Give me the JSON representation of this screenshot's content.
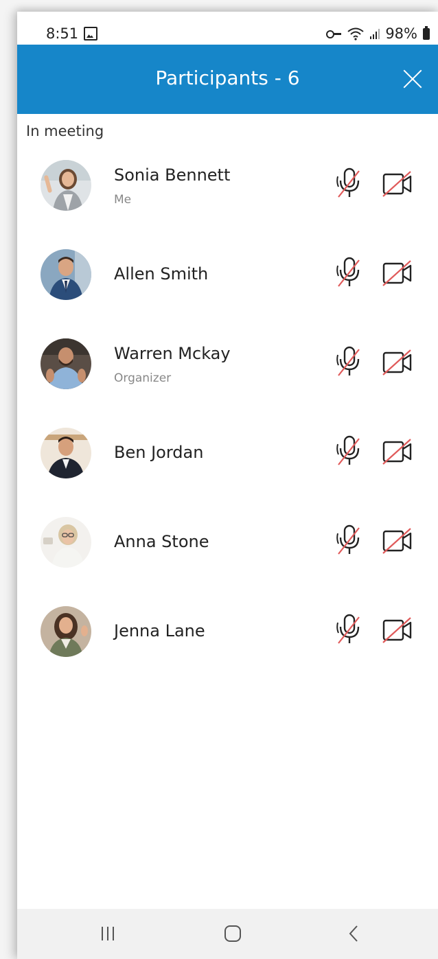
{
  "status_bar": {
    "time": "8:51",
    "battery": "98%",
    "icons": [
      "gallery-icon",
      "vpn-key-icon",
      "wifi-icon",
      "signal-icon",
      "battery-icon"
    ]
  },
  "header": {
    "title": "Participants - 6",
    "close_icon": "close-icon",
    "background": "#1686c9"
  },
  "section_label": "In meeting",
  "participants": [
    {
      "name": "Sonia Bennett",
      "role": "Me",
      "mic": "muted",
      "camera": "off"
    },
    {
      "name": "Allen Smith",
      "role": "",
      "mic": "muted",
      "camera": "off"
    },
    {
      "name": "Warren Mckay",
      "role": "Organizer",
      "mic": "muted",
      "camera": "off"
    },
    {
      "name": "Ben Jordan",
      "role": "",
      "mic": "muted",
      "camera": "off"
    },
    {
      "name": "Anna Stone",
      "role": "",
      "mic": "muted",
      "camera": "off"
    },
    {
      "name": "Jenna Lane",
      "role": "",
      "mic": "muted",
      "camera": "off"
    }
  ],
  "colors": {
    "accent": "#1686c9",
    "muted_slash": "#e05a5a",
    "text": "#222222",
    "subtext": "#888888"
  },
  "navbar": {
    "buttons": [
      "recent-apps-icon",
      "home-icon",
      "back-icon"
    ]
  }
}
